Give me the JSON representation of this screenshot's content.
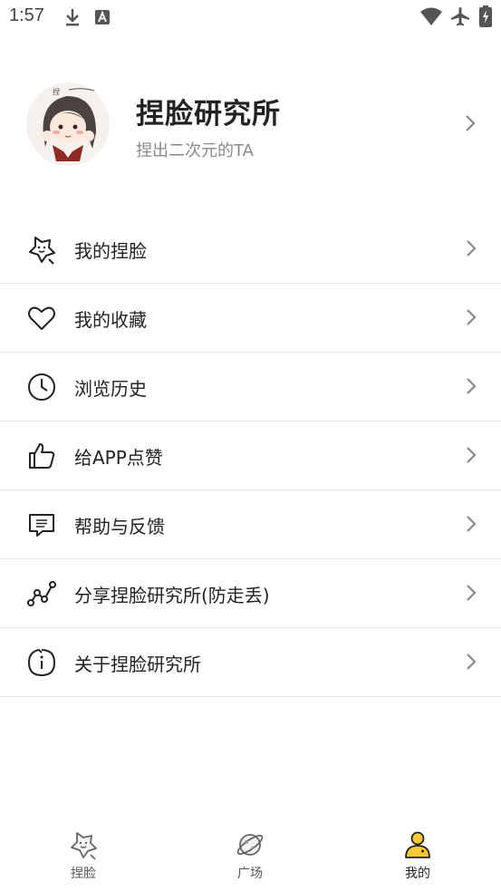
{
  "status_bar": {
    "time": "1:57",
    "icons": [
      "download-icon",
      "font-a-icon",
      "wifi-icon",
      "airplane-icon",
      "battery-charging-icon"
    ]
  },
  "profile": {
    "name": "捏脸研究所",
    "subtitle": "捏出二次元的TA",
    "avatar": "anime-girl-avatar"
  },
  "menu": {
    "items": [
      {
        "label": "我的捏脸",
        "icon": "star-face-icon"
      },
      {
        "label": "我的收藏",
        "icon": "heart-icon"
      },
      {
        "label": "浏览历史",
        "icon": "clock-icon"
      },
      {
        "label": "给APP点赞",
        "icon": "thumbs-up-icon"
      },
      {
        "label": "帮助与反馈",
        "icon": "message-icon"
      },
      {
        "label": "分享捏脸研究所(防走丢)",
        "icon": "share-nodes-icon"
      },
      {
        "label": "关于捏脸研究所",
        "icon": "info-icon"
      }
    ]
  },
  "tabbar": {
    "tabs": [
      {
        "label": "捏脸",
        "icon": "star-face-icon",
        "active": false
      },
      {
        "label": "广场",
        "icon": "planet-icon",
        "active": false
      },
      {
        "label": "我的",
        "icon": "user-icon",
        "active": true
      }
    ],
    "accent": "#F7C934"
  }
}
